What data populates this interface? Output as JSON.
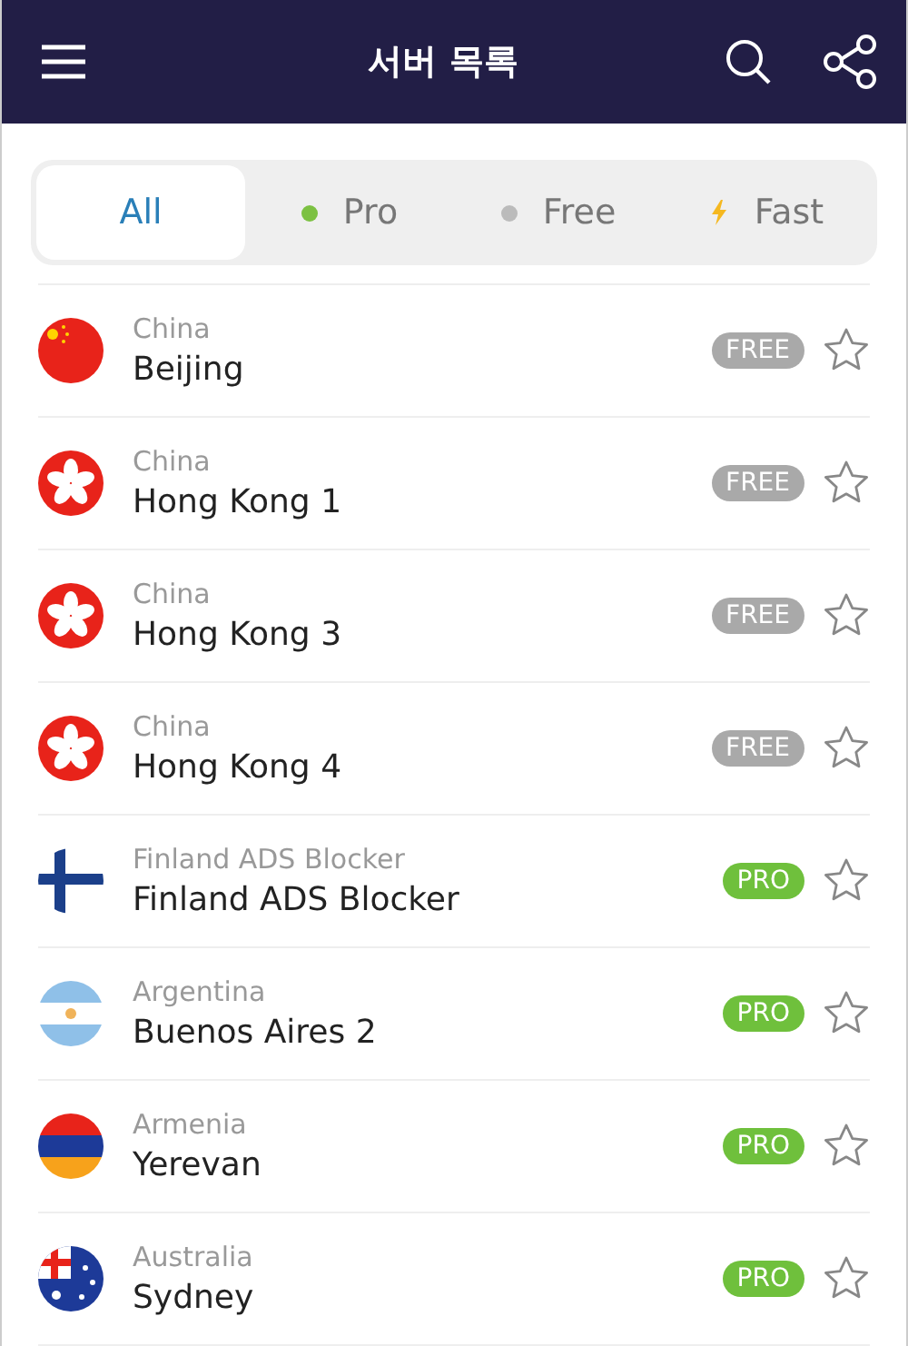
{
  "header": {
    "title": "서버 목록"
  },
  "tabs": [
    {
      "label": "All",
      "selected": true,
      "kind": "plain"
    },
    {
      "label": "Pro",
      "selected": false,
      "kind": "dot",
      "color": "#7cc142"
    },
    {
      "label": "Free",
      "selected": false,
      "kind": "dot",
      "color": "#bbbbbb"
    },
    {
      "label": "Fast",
      "selected": false,
      "kind": "bolt",
      "color": "#f5b820"
    }
  ],
  "servers": [
    {
      "country": "China",
      "city": "Beijing",
      "flag": {
        "kind": "china"
      },
      "badge": "FREE",
      "kind": "free",
      "favorite": false
    },
    {
      "country": "China",
      "city": "Hong Kong 1",
      "flag": {
        "kind": "hongkong"
      },
      "badge": "FREE",
      "kind": "free",
      "favorite": false
    },
    {
      "country": "China",
      "city": "Hong Kong 3",
      "flag": {
        "kind": "hongkong"
      },
      "badge": "FREE",
      "kind": "free",
      "favorite": false
    },
    {
      "country": "China",
      "city": "Hong Kong 4",
      "flag": {
        "kind": "hongkong"
      },
      "badge": "FREE",
      "kind": "free",
      "favorite": false
    },
    {
      "country": "Finland ADS Blocker",
      "city": "Finland ADS Blocker",
      "flag": {
        "kind": "finland"
      },
      "badge": "PRO",
      "kind": "pro",
      "favorite": false
    },
    {
      "country": "Argentina",
      "city": "Buenos Aires 2",
      "flag": {
        "kind": "argentina"
      },
      "badge": "PRO",
      "kind": "pro",
      "favorite": false
    },
    {
      "country": "Armenia",
      "city": "Yerevan",
      "flag": {
        "kind": "armenia"
      },
      "badge": "PRO",
      "kind": "pro",
      "favorite": false
    },
    {
      "country": "Australia",
      "city": "Sydney",
      "flag": {
        "kind": "australia"
      },
      "badge": "PRO",
      "kind": "pro",
      "favorite": false
    }
  ]
}
